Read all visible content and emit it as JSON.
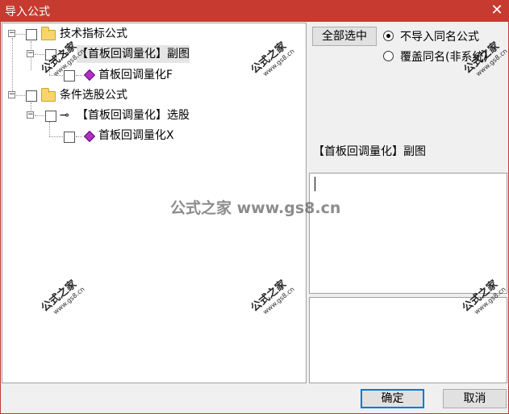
{
  "window": {
    "title": "导入公式",
    "close_glyph": "✕"
  },
  "tree": {
    "groups": [
      {
        "label": "技术指标公式",
        "children": [
          {
            "label": "【首板回调量化】副图",
            "children": [
              {
                "label": "首板回调量化F"
              }
            ]
          }
        ]
      },
      {
        "label": "条件选股公式",
        "children": [
          {
            "label": "【首板回调量化】选股",
            "children": [
              {
                "label": "首板回调量化X"
              }
            ]
          }
        ]
      }
    ],
    "expander_glyph": "−",
    "key_icon": "⊸"
  },
  "options": {
    "select_all_label": "全部选中",
    "radio_skip_label": "不导入同名公式",
    "radio_overwrite_label": "覆盖同名(非系统)",
    "selected_radio": "skip"
  },
  "detail": {
    "formula_name": "【首板回调量化】副图"
  },
  "buttons": {
    "ok_label": "确定",
    "cancel_label": "取消"
  },
  "watermark": {
    "text": "公式之家",
    "url": "www.gs8.cn",
    "center_text": "公式之家 www.gs8.cn"
  }
}
